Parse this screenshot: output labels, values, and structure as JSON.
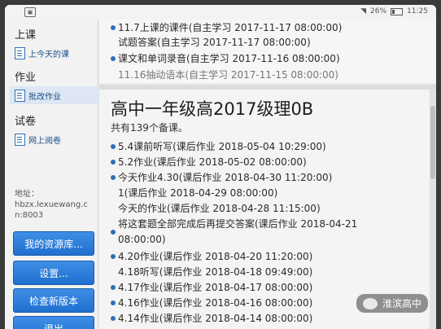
{
  "statusbar": {
    "left_icon": "▣",
    "signal": "◥",
    "battery_pct": "26%",
    "time": "11:25"
  },
  "sidebar": {
    "sections": [
      {
        "title": "上课",
        "item": "上今天的课"
      },
      {
        "title": "作业",
        "item": "批改作业"
      },
      {
        "title": "试卷",
        "item": "网上阅卷"
      }
    ],
    "address_label": "地址：",
    "address_value": "hbzx.lexuewang.cn:8003",
    "buttons": [
      "我的资源库...",
      "设置...",
      "检查新版本",
      "退出"
    ]
  },
  "top_list": [
    {
      "text": "11.7上课的课件(自主学习 2017-11-17 08:00:00)",
      "dot": true
    },
    {
      "text": "试题答案(自主学习 2017-11-17 08:00:00)",
      "dot": false
    },
    {
      "text": "课文和单词录音(自主学习 2017-11-16 08:00:00)",
      "dot": true
    },
    {
      "text": "11.16抽动语本(自主学习 2017-11-15 08:00:00)",
      "dot": false
    }
  ],
  "course": {
    "title": "高中一年级高2017级理0B",
    "count": "共有139个备课。"
  },
  "assignments": [
    {
      "text": "5.4课前听写(课后作业 2018-05-04 10:29:00)",
      "dot": true
    },
    {
      "text": "5.2作业(课后作业 2018-05-02 08:00:00)",
      "dot": true
    },
    {
      "text": "今天作业4.30(课后作业 2018-04-30 11:20:00)",
      "dot": true
    },
    {
      "text": "1(课后作业 2018-04-29 08:00:00)",
      "dot": false
    },
    {
      "text": "今天的作业(课后作业 2018-04-28 11:15:00)",
      "dot": false
    },
    {
      "text": "将这套题全部完成后再提交答案(课后作业 2018-04-21",
      "dot": true
    },
    {
      "text": "08:00:00)",
      "dot": false
    },
    {
      "text": "4.20作业(课后作业 2018-04-20 11:20:00)",
      "dot": true
    },
    {
      "text": "4.18听写(课后作业 2018-04-18 09:49:00)",
      "dot": false
    },
    {
      "text": "4.17作业(课后作业 2018-04-17 08:00:00)",
      "dot": true
    },
    {
      "text": "4.16作业(课后作业 2018-04-16 08:00:00)",
      "dot": true
    },
    {
      "text": "4.14作业(课后作业 2018-04-14 08:00:00)",
      "dot": true
    }
  ],
  "watermark": "淮滨高中"
}
